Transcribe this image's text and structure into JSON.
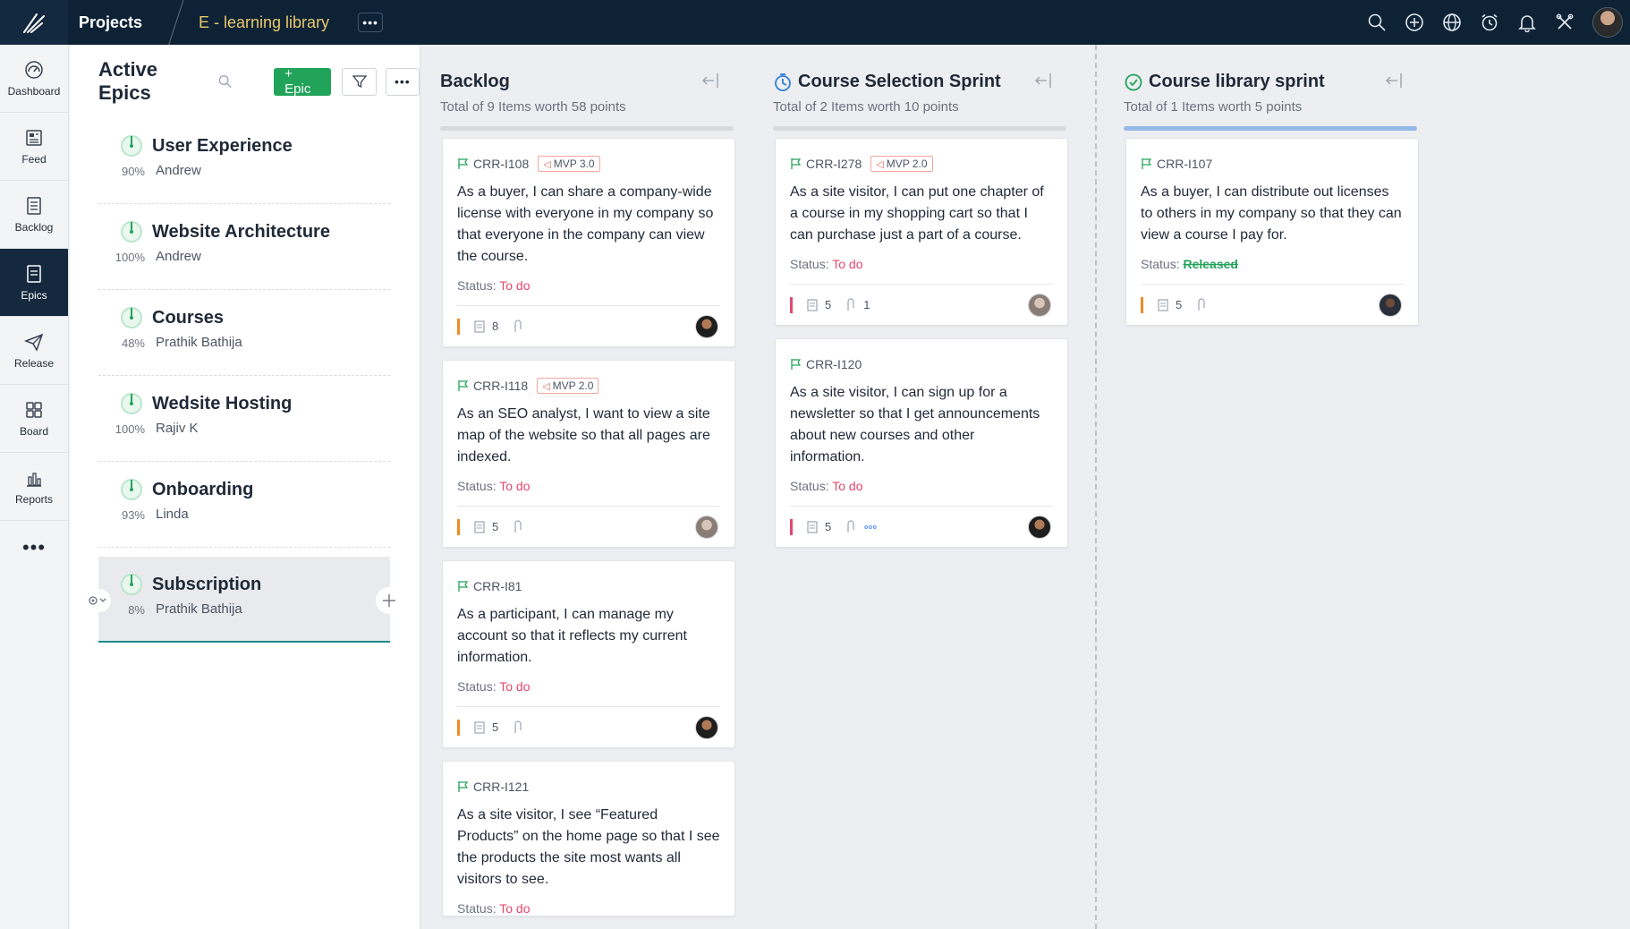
{
  "topbar": {
    "projects_label": "Projects",
    "project_name": "E - learning library",
    "more_label": "•••"
  },
  "leftnav": {
    "items": [
      {
        "label": "Dashboard",
        "icon": "dashboard-icon"
      },
      {
        "label": "Feed",
        "icon": "feed-icon"
      },
      {
        "label": "Backlog",
        "icon": "backlog-icon"
      },
      {
        "label": "Epics",
        "icon": "epics-icon",
        "active": true
      },
      {
        "label": "Release",
        "icon": "release-icon"
      },
      {
        "label": "Board",
        "icon": "board-icon"
      },
      {
        "label": "Reports",
        "icon": "reports-icon"
      }
    ],
    "more_label": "•••"
  },
  "epics": {
    "title": "Active Epics",
    "add_button": "+ Epic",
    "more_label": "•••",
    "items": [
      {
        "name": "User Experience",
        "percent": "90%",
        "owner": "Andrew"
      },
      {
        "name": "Website Architecture",
        "percent": "100%",
        "owner": "Andrew"
      },
      {
        "name": "Courses",
        "percent": "48%",
        "owner": "Prathik Bathija"
      },
      {
        "name": "Wedsite Hosting",
        "percent": "100%",
        "owner": "Rajiv K"
      },
      {
        "name": "Onboarding",
        "percent": "93%",
        "owner": "Linda"
      },
      {
        "name": "Subscription",
        "percent": "8%",
        "owner": "Prathik Bathija"
      }
    ]
  },
  "columns": {
    "backlog": {
      "title": "Backlog",
      "subtitle": "Total of 9 Items worth 58 points",
      "cards": [
        {
          "id": "CRR-I108",
          "tag": "MVP 3.0",
          "text": "As a buyer, I can share a company-wide license with everyone in my company so that everyone in the company can view the course.",
          "status_label": "Status:",
          "status": "To do",
          "points": "8"
        },
        {
          "id": "CRR-I118",
          "tag": "MVP 2.0",
          "text": "As an SEO analyst, I want to view a site map of the website so that all pages are indexed.",
          "status_label": "Status:",
          "status": "To do",
          "points": "5"
        },
        {
          "id": "CRR-I81",
          "text": "As a participant, I can manage my account so that it reflects my current information.",
          "status_label": "Status:",
          "status": "To do",
          "points": "5"
        },
        {
          "id": "CRR-I121",
          "text": "As a site visitor, I see “Featured Products” on the home page so that I see the products the site most wants all visitors to see.",
          "status_label": "Status:",
          "status": "To do"
        }
      ]
    },
    "sprint1": {
      "title": "Course Selection Sprint",
      "subtitle": "Total of 2 Items worth 10 points",
      "cards": [
        {
          "id": "CRR-I278",
          "tag": "MVP 2.0",
          "text": "As a site visitor, I can put one chapter of a course in my shopping cart so that I can purchase just a part of a course.",
          "status_label": "Status:",
          "status": "To do",
          "points": "5",
          "attachments": "1"
        },
        {
          "id": "CRR-I120",
          "text": "As a site visitor, I can sign up for a newsletter so that I get announcements about new courses and other information.",
          "status_label": "Status:",
          "status": "To do",
          "points": "5"
        }
      ]
    },
    "sprint2": {
      "title": "Course library sprint",
      "subtitle": "Total of 1 Items worth 5 points",
      "cards": [
        {
          "id": "CRR-I107",
          "text": "As a buyer, I can distribute out licenses to others in my company so that they can view a course I pay for.",
          "status_label": "Status:",
          "status": "Released",
          "points": "5"
        }
      ]
    }
  },
  "colors": {
    "topbar_bg": "#0e2236",
    "project_name": "#e8c86a",
    "accent_green": "#22a35a",
    "status_todo": "#e5466b",
    "priority_orange": "#f08a24"
  }
}
